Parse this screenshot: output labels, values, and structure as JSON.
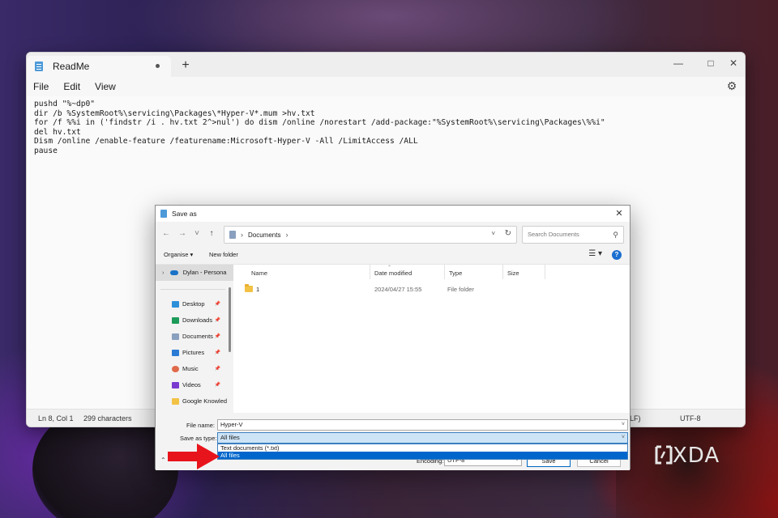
{
  "notepad": {
    "tab_title": "ReadMe",
    "new_tab": "+",
    "menu": [
      "File",
      "Edit",
      "View"
    ],
    "lines": [
      "pushd \"%~dp0\"",
      "dir /b %SystemRoot%\\servicing\\Packages\\*Hyper-V*.mum >hv.txt",
      "for /f %%i in ('findstr /i . hv.txt 2^>nul') do dism /online /norestart /add-package:\"%SystemRoot%\\servicing\\Packages\\%%i\"",
      "del hv.txt",
      "Dism /online /enable-feature /featurename:Microsoft-Hyper-V -All /LimitAccess /ALL",
      "pause"
    ],
    "status": {
      "position": "Ln 8, Col 1",
      "characters": "299 characters",
      "line_ending": "LF)",
      "encoding": "UTF-8"
    }
  },
  "dialog": {
    "title": "Save as",
    "address": "Documents",
    "search_placeholder": "Search Documents",
    "toolbar": {
      "organise": "Organise ▾",
      "new_folder": "New folder"
    },
    "sidebar": {
      "onedrive": "Dylan - Persona",
      "items": [
        {
          "label": "Desktop",
          "icon": "desktop-icon",
          "color": "#2d8fd8"
        },
        {
          "label": "Downloads",
          "icon": "download-icon",
          "color": "#1d9b5a"
        },
        {
          "label": "Documents",
          "icon": "documents-icon",
          "color": "#8aa0bf"
        },
        {
          "label": "Pictures",
          "icon": "pictures-icon",
          "color": "#2b7ad4"
        },
        {
          "label": "Music",
          "icon": "music-icon",
          "color": "#e06a4a"
        },
        {
          "label": "Videos",
          "icon": "videos-icon",
          "color": "#7a3ad0"
        },
        {
          "label": "Google Knowled",
          "icon": "folder-icon",
          "color": "#f2c245"
        }
      ]
    },
    "columns": [
      "Name",
      "Date modified",
      "Type",
      "Size"
    ],
    "files": [
      {
        "name": "1",
        "date": "2024/04/27 15:55",
        "type": "File folder",
        "size": ""
      }
    ],
    "file_name_label": "File name:",
    "file_name_value": "Hyper-V",
    "save_type_label": "Save as type:",
    "save_type_value": "All files",
    "save_type_options": [
      "Text documents (*.txt)",
      "All files"
    ],
    "encoding_label": "Encoding:",
    "encoding_value": "UTF-8",
    "save_button": "Save",
    "cancel_button": "Cancel"
  },
  "watermark": "XDA"
}
